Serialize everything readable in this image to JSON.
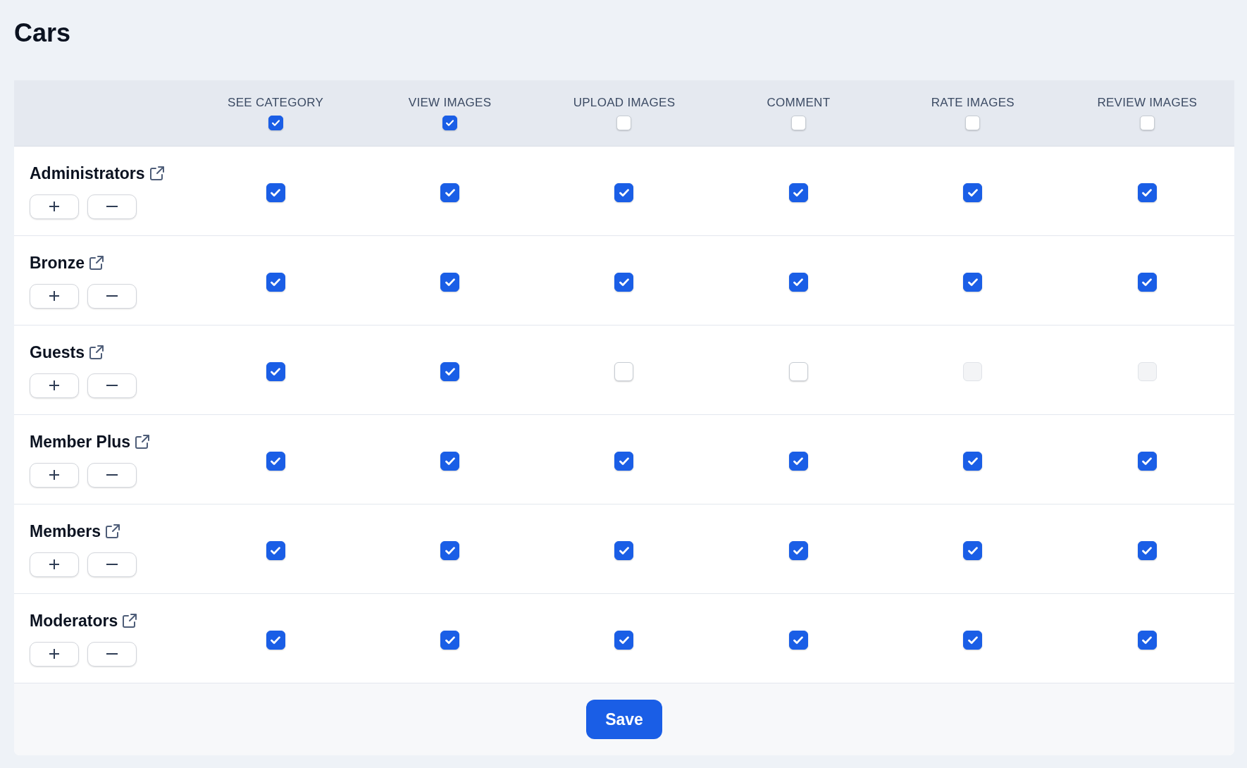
{
  "title": "Cars",
  "table": {
    "columns": [
      {
        "label": "SEE CATEGORY",
        "checked": true
      },
      {
        "label": "VIEW IMAGES",
        "checked": true
      },
      {
        "label": "UPLOAD IMAGES",
        "checked": false
      },
      {
        "label": "COMMENT",
        "checked": false
      },
      {
        "label": "RATE IMAGES",
        "checked": false
      },
      {
        "label": "REVIEW IMAGES",
        "checked": false
      }
    ],
    "rows": [
      {
        "group": "Administrators",
        "permissions": [
          {
            "checked": true,
            "disabled": false
          },
          {
            "checked": true,
            "disabled": false
          },
          {
            "checked": true,
            "disabled": false
          },
          {
            "checked": true,
            "disabled": false
          },
          {
            "checked": true,
            "disabled": false
          },
          {
            "checked": true,
            "disabled": false
          }
        ]
      },
      {
        "group": "Bronze",
        "permissions": [
          {
            "checked": true,
            "disabled": false
          },
          {
            "checked": true,
            "disabled": false
          },
          {
            "checked": true,
            "disabled": false
          },
          {
            "checked": true,
            "disabled": false
          },
          {
            "checked": true,
            "disabled": false
          },
          {
            "checked": true,
            "disabled": false
          }
        ]
      },
      {
        "group": "Guests",
        "permissions": [
          {
            "checked": true,
            "disabled": false
          },
          {
            "checked": true,
            "disabled": false
          },
          {
            "checked": false,
            "disabled": false
          },
          {
            "checked": false,
            "disabled": false
          },
          {
            "checked": false,
            "disabled": true
          },
          {
            "checked": false,
            "disabled": true
          }
        ]
      },
      {
        "group": "Member Plus",
        "permissions": [
          {
            "checked": true,
            "disabled": false
          },
          {
            "checked": true,
            "disabled": false
          },
          {
            "checked": true,
            "disabled": false
          },
          {
            "checked": true,
            "disabled": false
          },
          {
            "checked": true,
            "disabled": false
          },
          {
            "checked": true,
            "disabled": false
          }
        ]
      },
      {
        "group": "Members",
        "permissions": [
          {
            "checked": true,
            "disabled": false
          },
          {
            "checked": true,
            "disabled": false
          },
          {
            "checked": true,
            "disabled": false
          },
          {
            "checked": true,
            "disabled": false
          },
          {
            "checked": true,
            "disabled": false
          },
          {
            "checked": true,
            "disabled": false
          }
        ]
      },
      {
        "group": "Moderators",
        "permissions": [
          {
            "checked": true,
            "disabled": false
          },
          {
            "checked": true,
            "disabled": false
          },
          {
            "checked": true,
            "disabled": false
          },
          {
            "checked": true,
            "disabled": false
          },
          {
            "checked": true,
            "disabled": false
          },
          {
            "checked": true,
            "disabled": false
          }
        ]
      }
    ]
  },
  "save_button": "Save"
}
